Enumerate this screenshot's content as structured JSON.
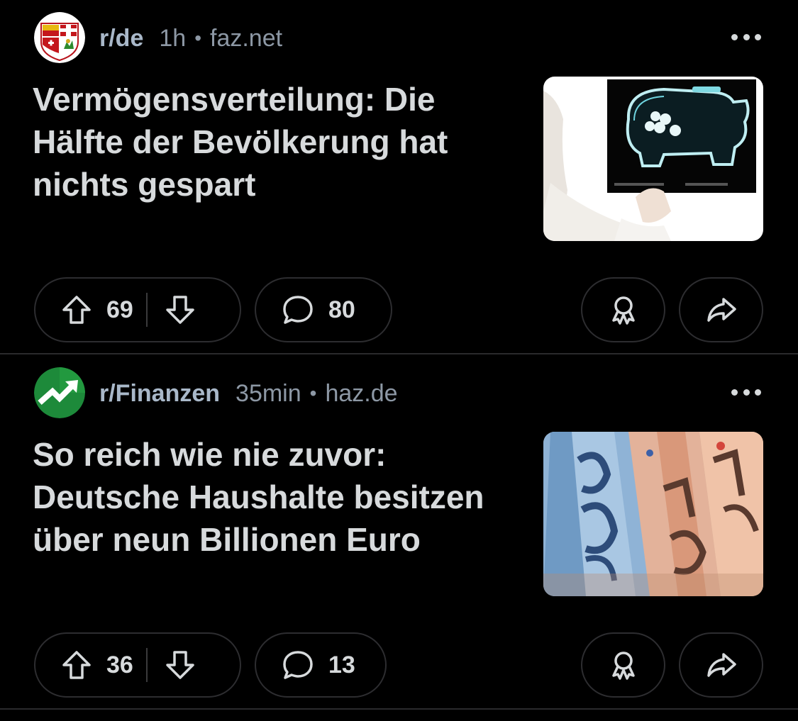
{
  "posts": [
    {
      "subreddit": "r/de",
      "time": "1h",
      "separator": "•",
      "domain": "faz.net",
      "title": "Vermögensverteilung: Die Hälfte der Bevölkerung hat nichts gespart",
      "upvotes": "69",
      "comments": "80",
      "avatar_icon": "coat-of-arms-icon",
      "thumbnail": "piggy-bank-xray-image"
    },
    {
      "subreddit": "r/Finanzen",
      "time": "35min",
      "separator": "•",
      "domain": "haz.de",
      "title": "So reich wie nie zuvor: Deutsche Haushalte besitzen über neun Billionen Euro",
      "upvotes": "36",
      "comments": "13",
      "avatar_icon": "trending-up-icon",
      "thumbnail": "euro-banknotes-image"
    }
  ],
  "icons": {
    "upvote": "arrow-up-icon",
    "downvote": "arrow-down-icon",
    "comment": "speech-bubble-icon",
    "award": "award-icon",
    "share": "share-arrow-icon",
    "more": "more-dots-icon"
  },
  "colors": {
    "background": "#000000",
    "text": "#d7dadc",
    "subreddit": "#a9b8c9",
    "meta": "#8d98a5",
    "border": "#2d2d30",
    "finanzen_green": "#1d8a3a"
  }
}
